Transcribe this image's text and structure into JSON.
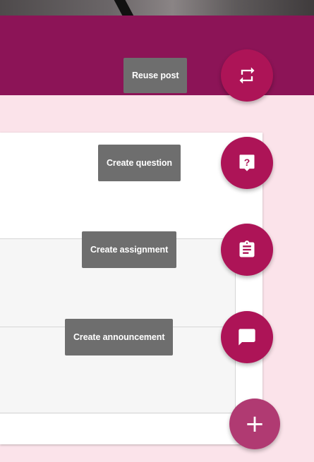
{
  "speed_dial": {
    "items": [
      {
        "label": "Reuse post",
        "icon": "repeat-icon"
      },
      {
        "label": "Create question",
        "icon": "question-icon"
      },
      {
        "label": "Create assignment",
        "icon": "clipboard-icon"
      },
      {
        "label": "Create announcement",
        "icon": "chat-icon"
      }
    ],
    "main_button": {
      "label": "+",
      "icon": "plus-icon"
    }
  },
  "colors": {
    "header": "#8c1457",
    "fab": "#ad1457",
    "fab_main": "#b03a72",
    "tooltip": "#6e6e6e",
    "page_background": "#fbe3ea"
  }
}
